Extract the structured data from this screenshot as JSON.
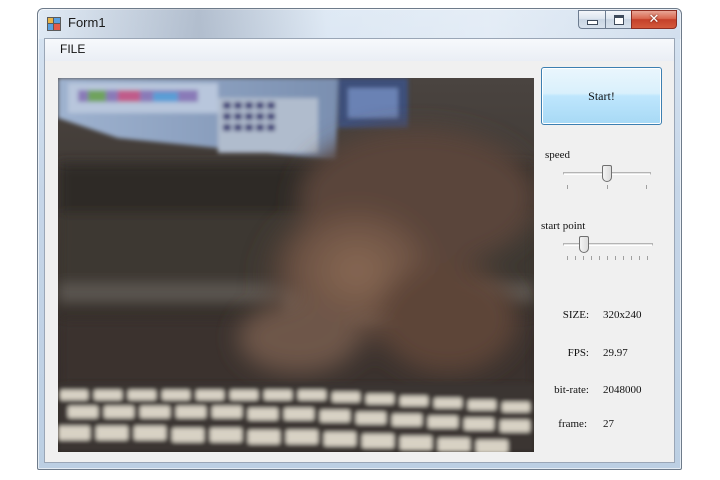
{
  "window": {
    "title": "Form1",
    "close_glyph": "✕"
  },
  "menu": {
    "items": [
      "FILE"
    ]
  },
  "controls": {
    "start_label": "Start!",
    "speed_label": "speed",
    "start_point_label": "start point",
    "speed_value": 0.5,
    "start_point_value": 0.2
  },
  "info": {
    "size": {
      "key": "SIZE:",
      "value": "320x240"
    },
    "fps": {
      "key": "FPS:",
      "value": "29.97"
    },
    "bitrate": {
      "key": "bit-rate:",
      "value": "2048000"
    },
    "frame": {
      "key": "frame:",
      "value": "27"
    }
  },
  "icons": {
    "app": "app-icon",
    "minimize": "minimize-icon",
    "maximize": "maximize-icon",
    "close": "close-icon"
  }
}
